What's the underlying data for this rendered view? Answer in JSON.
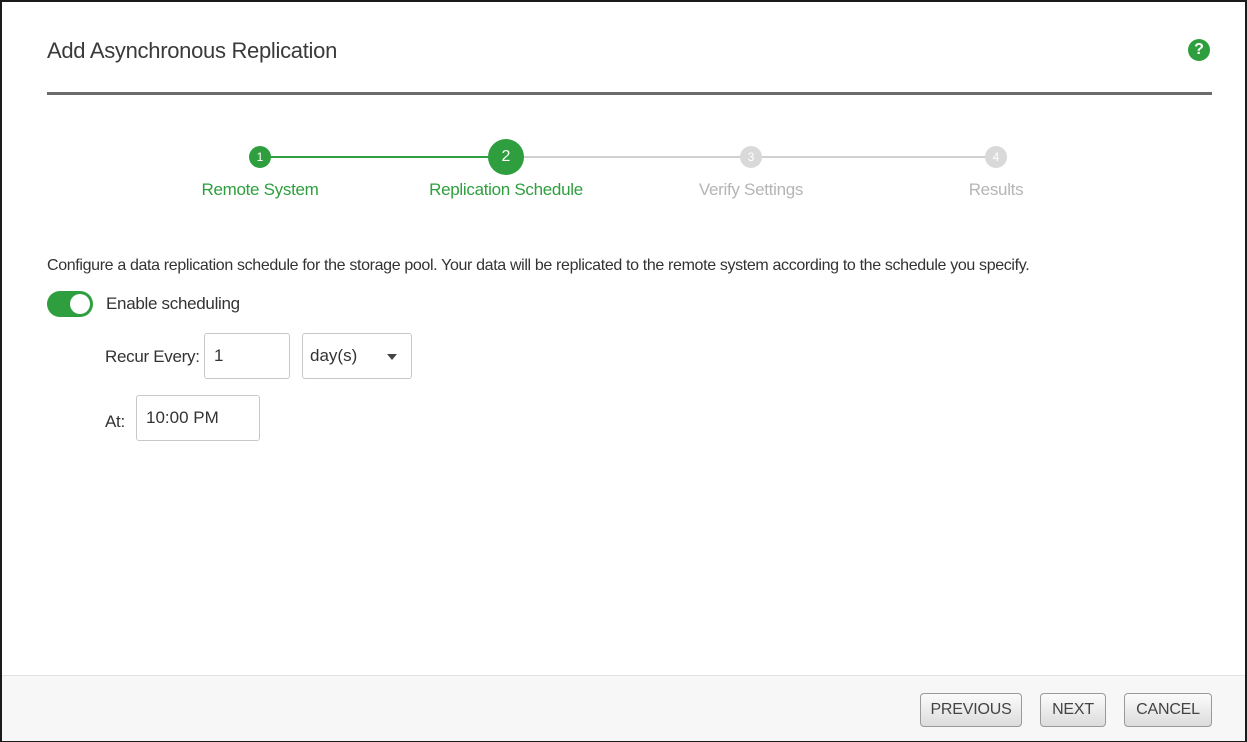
{
  "dialog": {
    "title": "Add Asynchronous Replication",
    "help_icon": "question-circle-icon",
    "help_glyph": "?"
  },
  "wizard": {
    "steps": [
      {
        "number": "1",
        "label": "Remote System",
        "state": "done"
      },
      {
        "number": "2",
        "label": "Replication Schedule",
        "state": "current"
      },
      {
        "number": "3",
        "label": "Verify Settings",
        "state": "todo"
      },
      {
        "number": "4",
        "label": "Results",
        "state": "todo"
      }
    ]
  },
  "content": {
    "description": "Configure a data replication schedule for the storage pool. Your data will be replicated to the remote system according to the schedule you specify.",
    "enable_scheduling": {
      "label": "Enable scheduling",
      "on": true
    },
    "recur_every": {
      "label": "Recur Every:",
      "value": "1"
    },
    "recur_unit": {
      "value": "day(s)"
    },
    "at": {
      "label": "At:",
      "value": "10:00 PM"
    }
  },
  "footer": {
    "previous_label": "PREVIOUS",
    "next_label": "NEXT",
    "cancel_label": "CANCEL"
  },
  "colors": {
    "accent": "#2e9e3e",
    "inactive": "#d9d9d9"
  }
}
